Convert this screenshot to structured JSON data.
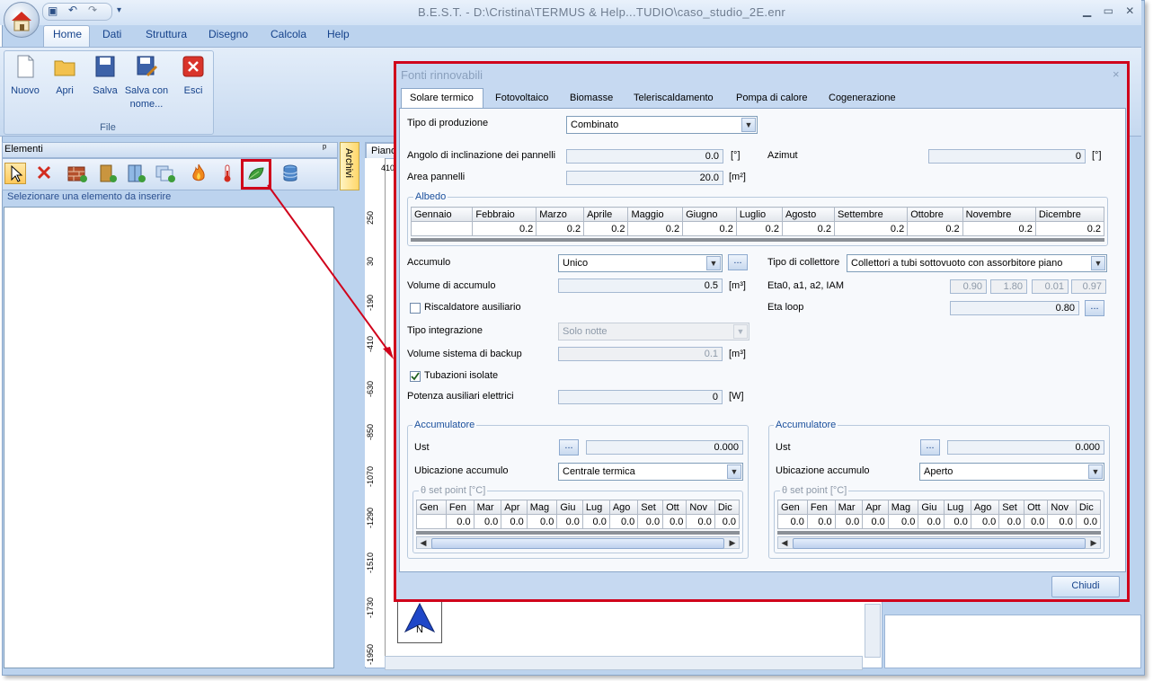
{
  "app": {
    "title": "B.E.S.T. - D:\\Cristina\\TERMUS & Help...TUDIO\\caso_studio_2E.enr",
    "menu": [
      "Home",
      "Dati",
      "Struttura",
      "Disegno",
      "Calcola",
      "Help"
    ],
    "ribbon": {
      "buttons": [
        "Nuovo",
        "Apri",
        "Salva",
        "Salva con",
        "nome...",
        "Esci"
      ],
      "group_label": "File"
    },
    "elements_panel": {
      "title": "Elementi",
      "hint": "Selezionare una elemento da inserire",
      "archivi_tab": "Archivi"
    },
    "canvas_tab": "Piano",
    "ruler_ticks": [
      "250",
      "30",
      "-190",
      "-410",
      "-630",
      "-850",
      "-1070",
      "-1290",
      "-1510",
      "-1730",
      "-1950"
    ],
    "ruler_top": "410",
    "north_label": "N"
  },
  "dialog": {
    "title": "Fonti rinnovabili",
    "close": "×",
    "tabs": [
      "Solare termico",
      "Fotovoltaico",
      "Biomasse",
      "Teleriscaldamento",
      "Pompa di calore",
      "Cogenerazione"
    ],
    "tipo_produzione": {
      "label": "Tipo di produzione",
      "value": "Combinato"
    },
    "angolo": {
      "label": "Angolo di inclinazione dei pannelli",
      "value": "0.0",
      "unit": "[°]"
    },
    "azimut": {
      "label": "Azimut",
      "value": "0",
      "unit": "[°]"
    },
    "area": {
      "label": "Area pannelli",
      "value": "20.0",
      "unit": "[m²]"
    },
    "albedo": {
      "title": "Albedo",
      "months": [
        "Gennaio",
        "Febbraio",
        "Marzo",
        "Aprile",
        "Maggio",
        "Giugno",
        "Luglio",
        "Agosto",
        "Settembre",
        "Ottobre",
        "Novembre",
        "Dicembre"
      ],
      "values": [
        "0.2",
        "0.2",
        "0.2",
        "0.2",
        "0.2",
        "0.2",
        "0.2",
        "0.2",
        "0.2",
        "0.2",
        "0.2",
        "0.2"
      ]
    },
    "accumulo": {
      "label": "Accumulo",
      "value": "Unico",
      "dots": "..."
    },
    "volume_accumulo": {
      "label": "Volume di accumulo",
      "value": "0.5",
      "unit": "[m³]"
    },
    "riscaldatore": {
      "label": "Riscaldatore ausiliario"
    },
    "tipo_integrazione": {
      "label": "Tipo integrazione",
      "value": "Solo notte"
    },
    "volume_backup": {
      "label": "Volume sistema di backup",
      "value": "0.1",
      "unit": "[m³]"
    },
    "tubazioni": {
      "label": "Tubazioni isolate"
    },
    "potenza": {
      "label": "Potenza ausiliari elettrici",
      "value": "0",
      "unit": "[W]"
    },
    "tipo_collettore": {
      "label": "Tipo di collettore",
      "value": "Collettori a tubi sottovuoto con assorbitore piano"
    },
    "eta": {
      "label": "Eta0, a1, a2, IAM",
      "values": [
        "0.90",
        "1.80",
        "0.01",
        "0.97"
      ]
    },
    "eta_loop": {
      "label": "Eta loop",
      "value": "0.80",
      "dots": "..."
    },
    "accumulatore_left": {
      "title": "Accumulatore",
      "ust_label": "Ust",
      "ust_value": "0.000",
      "dots": "...",
      "ubicazione_label": "Ubicazione accumulo",
      "ubicazione_value": "Centrale termica",
      "setpoint_title": "θ set point [°C]",
      "months": [
        "Gen",
        "Fen",
        "Mar",
        "Apr",
        "Mag",
        "Giu",
        "Lug",
        "Ago",
        "Set",
        "Ott",
        "Nov",
        "Dic"
      ],
      "values": [
        "0.0",
        "0.0",
        "0.0",
        "0.0",
        "0.0",
        "0.0",
        "0.0",
        "0.0",
        "0.0",
        "0.0",
        "0.0",
        "0.0"
      ]
    },
    "accumulatore_right": {
      "title": "Accumulatore",
      "ust_label": "Ust",
      "ust_value": "0.000",
      "dots": "...",
      "ubicazione_label": "Ubicazione accumulo",
      "ubicazione_value": "Aperto",
      "setpoint_title": "θ set point [°C]",
      "months": [
        "Gen",
        "Fen",
        "Mar",
        "Apr",
        "Mag",
        "Giu",
        "Lug",
        "Ago",
        "Set",
        "Ott",
        "Nov",
        "Dic"
      ],
      "values": [
        "0.0",
        "0.0",
        "0.0",
        "0.0",
        "0.0",
        "0.0",
        "0.0",
        "0.0",
        "0.0",
        "0.0",
        "0.0",
        "0.0"
      ]
    },
    "chiudi": "Chiudi"
  },
  "colors": {
    "highlight": "#d0021b",
    "ribbon_text": "#15428b",
    "selection": "#3169c6"
  }
}
